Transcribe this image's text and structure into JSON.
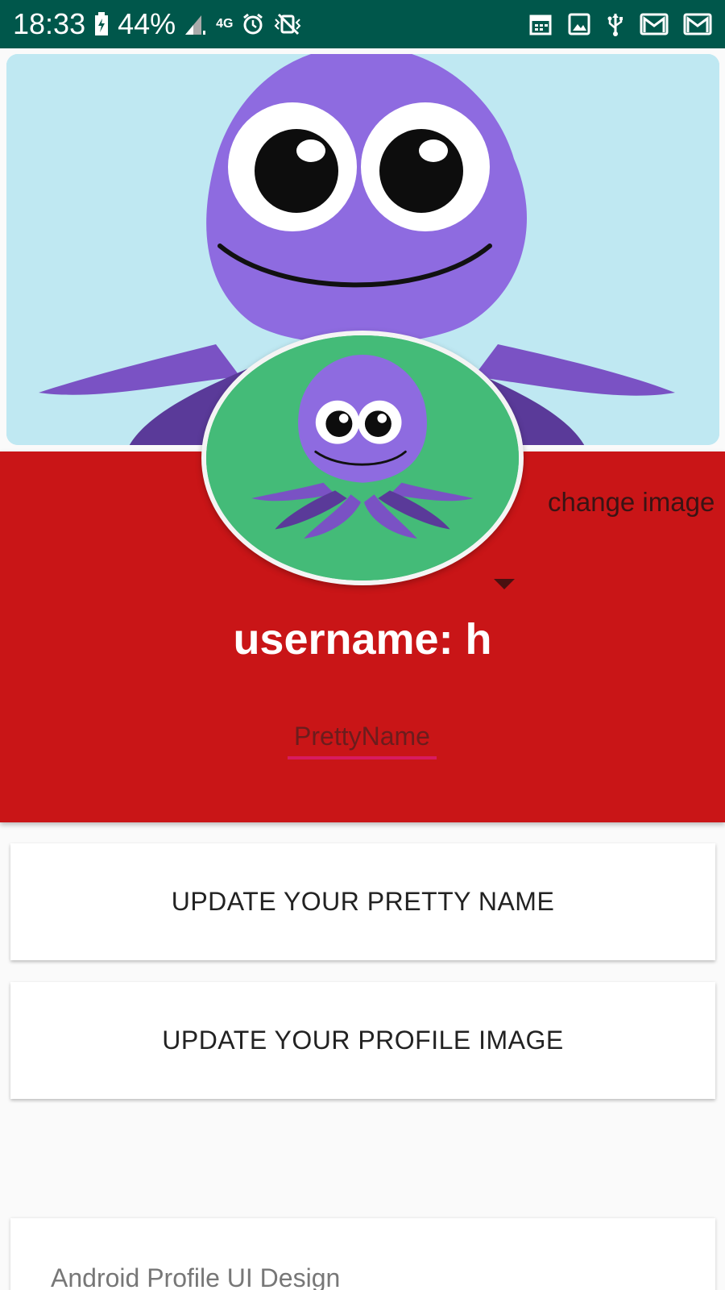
{
  "status_bar": {
    "time": "18:33",
    "battery": "44%",
    "network": "4G",
    "icons": [
      "battery-charging-icon",
      "signal-icon",
      "data-4g-icon",
      "alarm-icon",
      "vibrate-icon",
      "calendar-icon",
      "image-icon",
      "usb-icon",
      "gmail-icon",
      "gmail-icon"
    ]
  },
  "profile": {
    "change_image_label": "change image",
    "username_text": "username: h",
    "pretty_name_placeholder": "PrettyName"
  },
  "actions": {
    "update_pretty_name": "UPDATE YOUR PRETTY NAME",
    "update_profile_image": "UPDATE YOUR PROFILE IMAGE"
  },
  "footer": {
    "caption": "Android Profile UI Design"
  },
  "colors": {
    "status_bar": "#00574b",
    "header_red": "#c91517",
    "cover_bg": "#bfe8f2",
    "avatar_bg": "#44bb78",
    "accent_underline": "#d81b60",
    "octopus": "#8e6be0"
  }
}
